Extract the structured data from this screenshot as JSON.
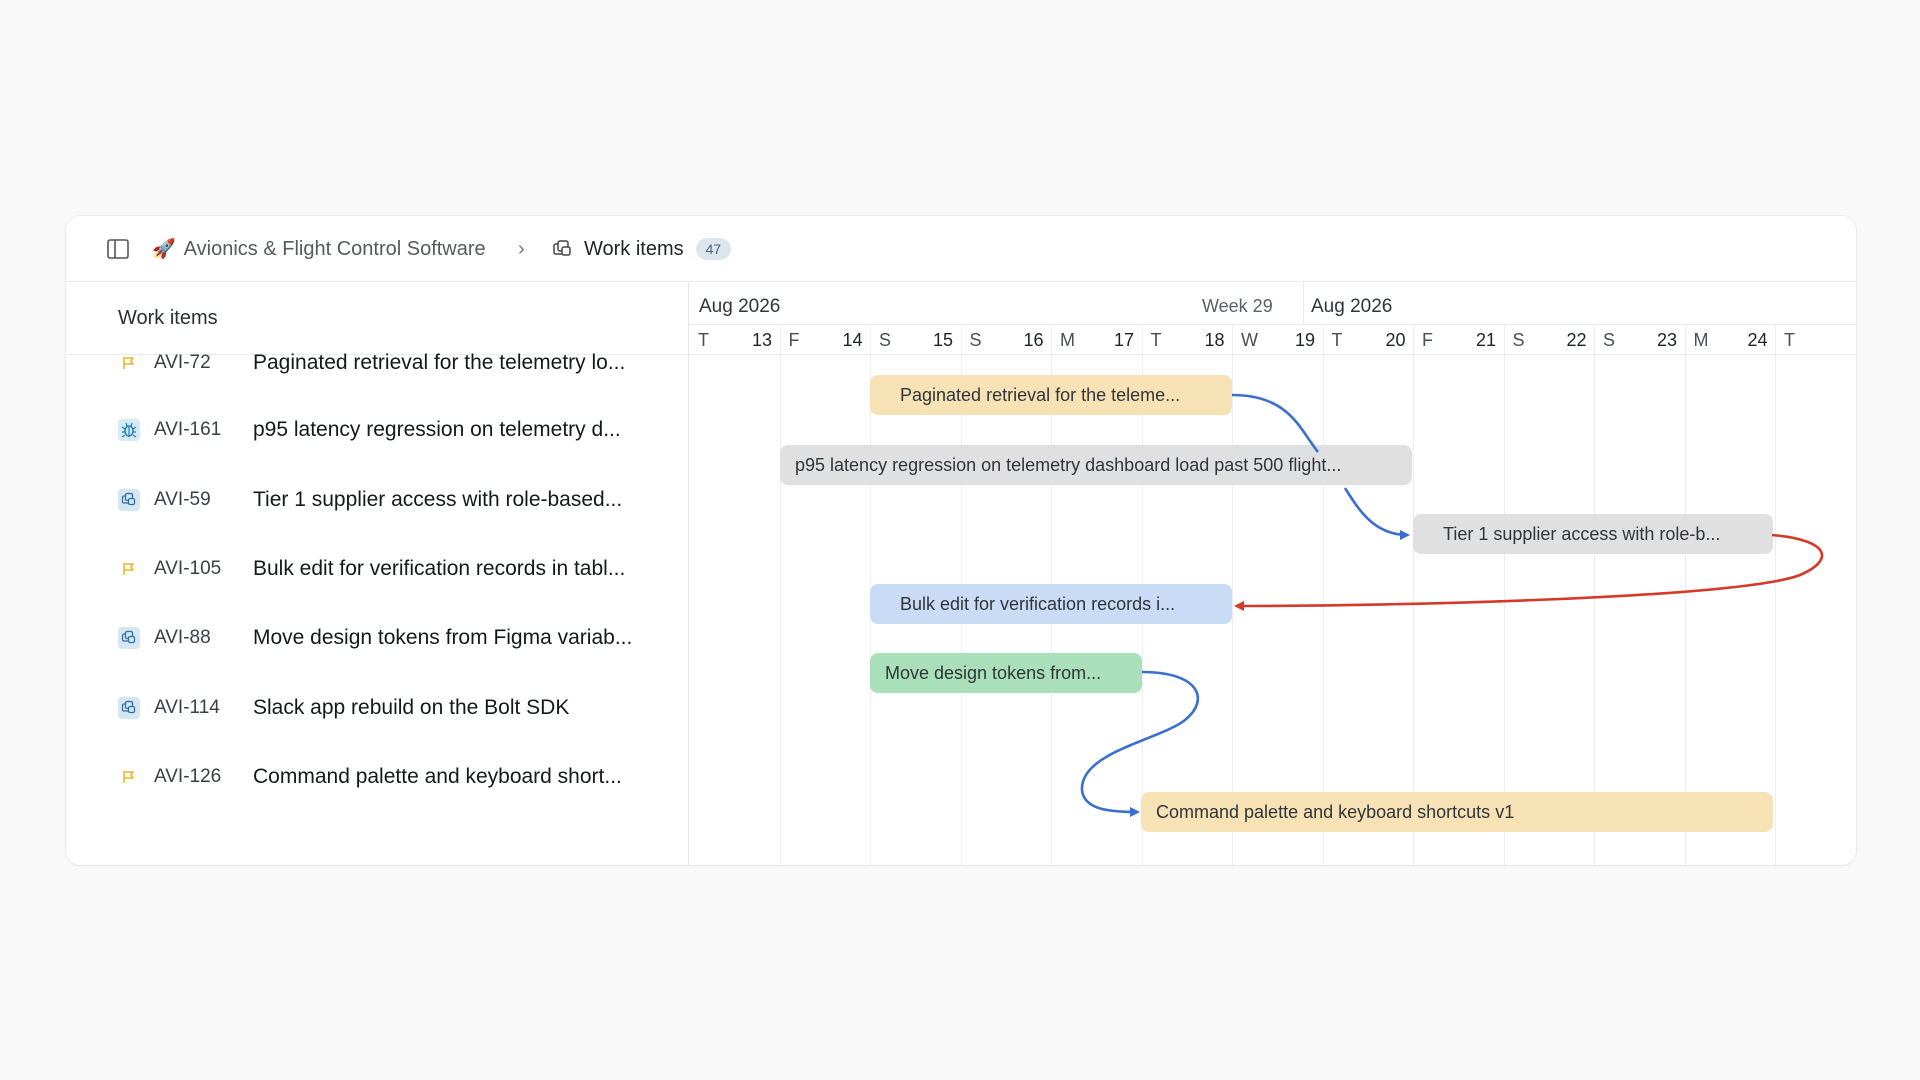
{
  "breadcrumb": {
    "project_emoji": "🚀",
    "project": "Avionics & Flight Control Software",
    "separator": "›",
    "current": "Work items",
    "count": "47"
  },
  "list": {
    "header": "Work items",
    "rows": [
      {
        "id": "AVI-72",
        "type": "flag-icon",
        "title": "Paginated retrieval for the telemetry lo..."
      },
      {
        "id": "AVI-161",
        "type": "bug-icon",
        "title": "p95 latency regression on telemetry d..."
      },
      {
        "id": "AVI-59",
        "type": "layers-icon",
        "title": "Tier 1 supplier access with role-based..."
      },
      {
        "id": "AVI-105",
        "type": "flag-icon",
        "title": "Bulk edit for verification records in tabl..."
      },
      {
        "id": "AVI-88",
        "type": "layers-icon",
        "title": "Move design tokens from Figma variab..."
      },
      {
        "id": "AVI-114",
        "type": "layers-icon",
        "title": "Slack app rebuild on the Bolt SDK"
      },
      {
        "id": "AVI-126",
        "type": "flag-icon",
        "title": "Command palette and keyboard short..."
      }
    ]
  },
  "timeline": {
    "month_left": "Aug 2026",
    "week_label": "Week 29",
    "month_right": "Aug 2026",
    "days": [
      {
        "l": "T",
        "n": "13"
      },
      {
        "l": "F",
        "n": "14"
      },
      {
        "l": "S",
        "n": "15"
      },
      {
        "l": "S",
        "n": "16"
      },
      {
        "l": "M",
        "n": "17"
      },
      {
        "l": "T",
        "n": "18"
      },
      {
        "l": "W",
        "n": "19"
      },
      {
        "l": "T",
        "n": "20"
      },
      {
        "l": "F",
        "n": "21"
      },
      {
        "l": "S",
        "n": "22"
      },
      {
        "l": "S",
        "n": "23"
      },
      {
        "l": "M",
        "n": "24"
      },
      {
        "l": "T",
        "n": ""
      }
    ],
    "bars": [
      {
        "label": "Paginated retrieval for the teleme...",
        "color": "#f7e2b5"
      },
      {
        "label": "p95 latency regression on telemetry dashboard load past 500 flight...",
        "color": "#e0e0e0"
      },
      {
        "label": "Tier 1 supplier access with role-b...",
        "color": "#e0e0e0"
      },
      {
        "label": "Bulk edit for verification records i...",
        "color": "#c9dbf5"
      },
      {
        "label": "Move design tokens from...",
        "color": "#a9e0b9"
      },
      {
        "label": "Command palette and keyboard shortcuts v1",
        "color": "#f7e2b5"
      }
    ]
  },
  "colors": {
    "flag": "#f0b429",
    "bug_bg": "#d6eaf5",
    "bug": "#1f7fb6",
    "layers_bg": "#d6e6f2",
    "layers": "#2f6f9f",
    "dependency": "#3a6fd0",
    "conflict": "#d43a2a"
  }
}
